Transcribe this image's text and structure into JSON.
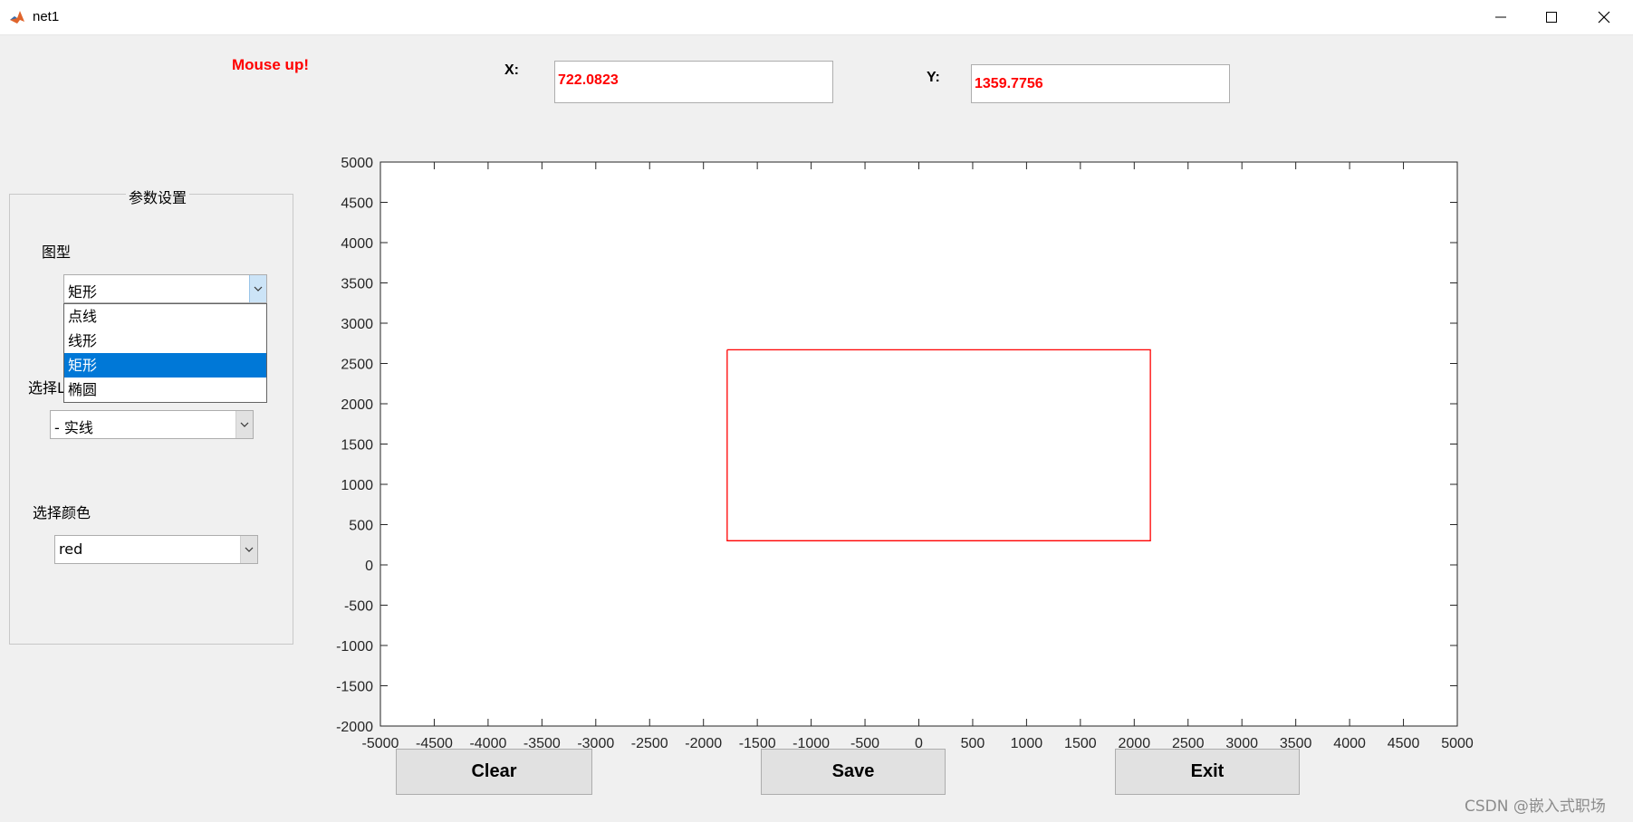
{
  "window": {
    "title": "net1",
    "controls": [
      "minimize-icon",
      "maximize-icon",
      "close-icon"
    ]
  },
  "status": {
    "text": "Mouse up!",
    "color": "#ff0000"
  },
  "coords": {
    "x_label": "X:",
    "x_value": "722.0823",
    "y_label": "Y:",
    "y_value": "1359.7756"
  },
  "panel": {
    "title": "参数设置",
    "shape": {
      "label": "图型",
      "selected": "矩形",
      "options": [
        "点线",
        "线形",
        "矩形",
        "椭圆"
      ],
      "selected_index": 2
    },
    "line_style": {
      "label_visible": "选择L",
      "selected": "- 实线"
    },
    "color": {
      "label": "选择颜色",
      "selected": "red"
    }
  },
  "chart_data": {
    "type": "line",
    "xlim": [
      -5000,
      5000
    ],
    "ylim": [
      -2000,
      5000
    ],
    "xticks": [
      -5000,
      -4500,
      -4000,
      -3500,
      -3000,
      -2500,
      -2000,
      -1500,
      -1000,
      -500,
      0,
      500,
      1000,
      1500,
      2000,
      2500,
      3000,
      3500,
      4000,
      4500,
      5000
    ],
    "yticks": [
      -2000,
      -1500,
      -1000,
      -500,
      0,
      500,
      1000,
      1500,
      2000,
      2500,
      3000,
      3500,
      4000,
      4500,
      5000
    ],
    "grid": false,
    "series": [
      {
        "x": [
          -1780,
          2150,
          2150,
          -1780,
          -1780
        ],
        "y": [
          2670,
          2670,
          300,
          300,
          2670
        ],
        "color": "#ff0000"
      }
    ]
  },
  "buttons": {
    "clear": "Clear",
    "save": "Save",
    "exit": "Exit"
  },
  "watermark": "CSDN @嵌入式职场"
}
